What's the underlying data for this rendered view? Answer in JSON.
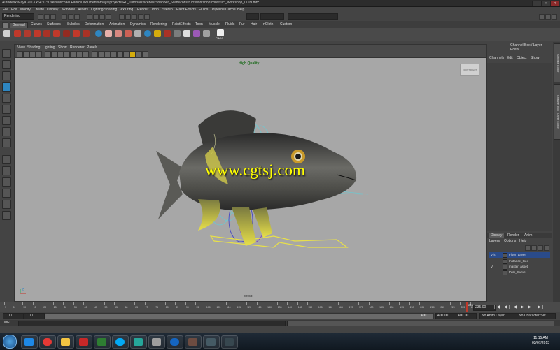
{
  "window": {
    "title": "Autodesk Maya 2013 x64: C:\\Users\\Michael Fabro\\Documents\\maya\\projects\\RL_Tutorials\\scenes\\Snapper_Swim\\construct\\workshop\\construct_workshop_0009.mb*",
    "minimize": "–",
    "maximize": "□",
    "close": "✕"
  },
  "menubar": [
    "File",
    "Edit",
    "Modify",
    "Create",
    "Display",
    "Window",
    "Assets",
    "Lighting/Shading",
    "Texturing",
    "Render",
    "Toon",
    "Stereo",
    "Paint Effects",
    "Fluids",
    "Pipeline Cache",
    "Help"
  ],
  "status_line": {
    "mode": "Rendering"
  },
  "shelf_tabs": [
    "General",
    "Curves",
    "Surfaces",
    "Subdivs",
    "Deformation",
    "Animation",
    "Dynamics",
    "Rendering",
    "PaintEffects",
    "Toon",
    "Muscle",
    "Fluids",
    "Fur",
    "Hair",
    "nCloth",
    "Custom"
  ],
  "shelf_active_tab": "General",
  "shelf_icon_label": "FBxX",
  "viewport": {
    "menu": [
      "View",
      "Shading",
      "Lighting",
      "Show",
      "Renderer",
      "Panels"
    ],
    "hud_quality": "High Quality",
    "camera_label": "persp",
    "viewcube": "FRONT  RIGHT",
    "axis_label": "Z"
  },
  "watermark": "www.cgtsj.com",
  "channel_box": {
    "title": "Channel Box / Layer Editor",
    "menu": [
      "Channels",
      "Edit",
      "Object",
      "Show"
    ]
  },
  "side_tabs": [
    "Attribute Editor",
    "Channel Box / Layer Editor"
  ],
  "layer_editor": {
    "tabs": [
      "Display",
      "Render",
      "Anim"
    ],
    "active_tab": "Display",
    "menu": [
      "Layers",
      "Options",
      "Help"
    ],
    "layers": [
      {
        "v": "V/s",
        "name": "Floor_Layer",
        "color": "#2a4b8a",
        "selected": true
      },
      {
        "v": "",
        "name": "Instance_Geo",
        "color": "#555555",
        "selected": false
      },
      {
        "v": "V",
        "name": "master_asset",
        "color": "#555555",
        "selected": false
      },
      {
        "v": "",
        "name": "Path_Curve",
        "color": "#555555",
        "selected": false
      }
    ]
  },
  "time_slider": {
    "ticks": [
      "1",
      "5",
      "10",
      "15",
      "20",
      "25",
      "30",
      "35",
      "40",
      "45",
      "50",
      "55",
      "60",
      "65",
      "70",
      "75",
      "80",
      "85",
      "90",
      "95",
      "100",
      "105",
      "110",
      "115",
      "120",
      "125",
      "130",
      "135",
      "140",
      "145",
      "150",
      "155",
      "160",
      "165",
      "170",
      "175",
      "180",
      "185",
      "190",
      "195",
      "200",
      "205",
      "210",
      "215",
      "220",
      "225",
      "230"
    ],
    "current_frame": "228",
    "current_frame_value": 228,
    "frame_min": 1,
    "frame_max": 230,
    "end_field": "235.00"
  },
  "range_slider": {
    "start": "1.00",
    "start2": "1.00",
    "start3": "1",
    "range_end": "400",
    "end": "400.00",
    "end2": "400.00",
    "anim_layer": "No Anim Layer",
    "char_set": "No Character Set"
  },
  "command_line": {
    "lang": "MEL"
  },
  "taskbar": {
    "time": "11:15 AM",
    "date": "03/07/2013"
  }
}
